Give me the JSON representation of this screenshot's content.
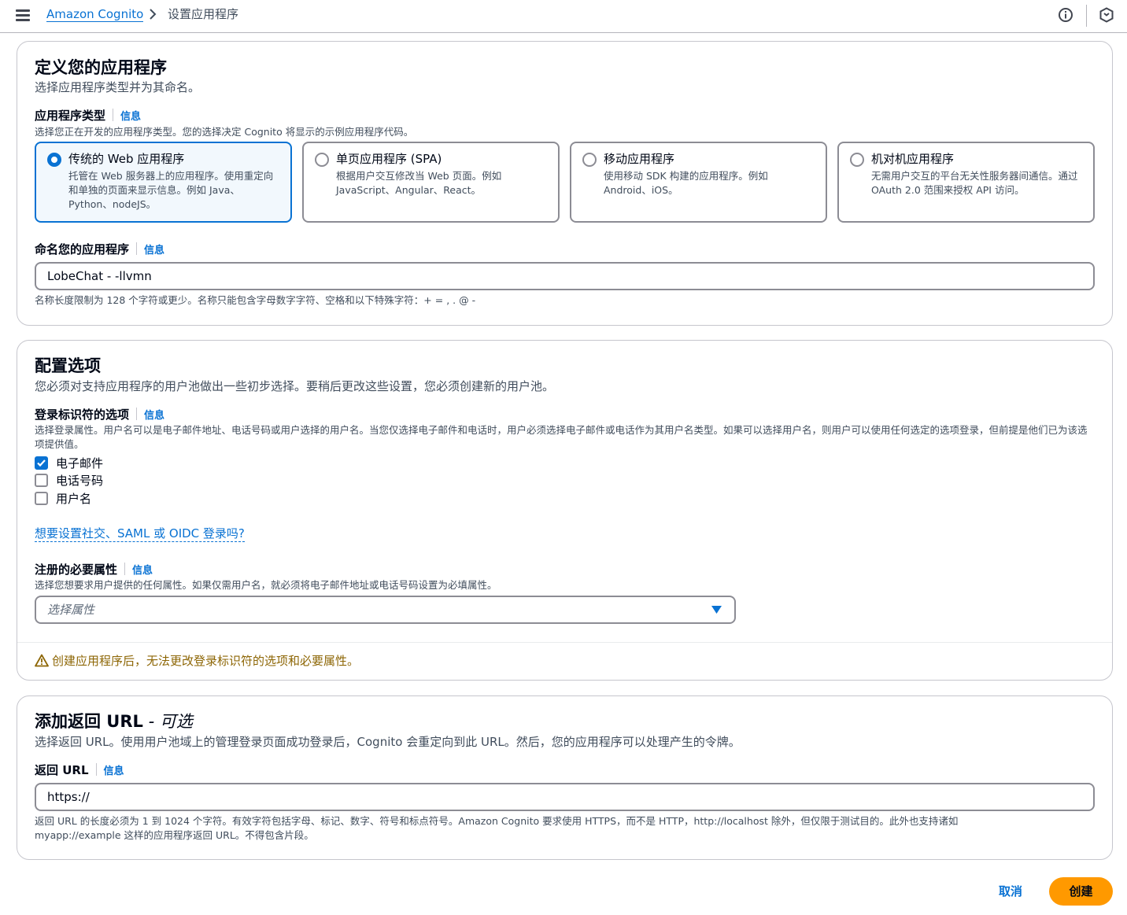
{
  "header": {
    "breadcrumb_root": "Amazon Cognito",
    "breadcrumb_current": "设置应用程序"
  },
  "define_app": {
    "title": "定义您的应用程序",
    "subtitle": "选择应用程序类型并为其命名。",
    "app_type": {
      "label": "应用程序类型",
      "info": "信息",
      "hint": "选择您正在开发的应用程序类型。您的选择决定 Cognito 将显示的示例应用程序代码。",
      "options": [
        {
          "title": "传统的 Web 应用程序",
          "desc": "托管在 Web 服务器上的应用程序。使用重定向和单独的页面来显示信息。例如 Java、Python、nodeJS。",
          "selected": true
        },
        {
          "title": "单页应用程序 (SPA)",
          "desc": "根据用户交互修改当 Web 页面。例如 JavaScript、Angular、React。",
          "selected": false
        },
        {
          "title": "移动应用程序",
          "desc": "使用移动 SDK 构建的应用程序。例如 Android、iOS。",
          "selected": false
        },
        {
          "title": "机对机应用程序",
          "desc": "无需用户交互的平台无关性服务器间通信。通过 OAuth 2.0 范围来授权 API 访问。",
          "selected": false
        }
      ]
    },
    "app_name": {
      "label": "命名您的应用程序",
      "info": "信息",
      "value": "LobeChat - -llvmn",
      "hint": "名称长度限制为 128 个字符或更少。名称只能包含字母数字字符、空格和以下特殊字符：+ = , . @ -"
    }
  },
  "config": {
    "title": "配置选项",
    "subtitle": "您必须对支持应用程序的用户池做出一些初步选择。要稍后更改这些设置，您必须创建新的用户池。",
    "signin": {
      "label": "登录标识符的选项",
      "info": "信息",
      "hint": "选择登录属性。用户名可以是电子邮件地址、电话号码或用户选择的用户名。当您仅选择电子邮件和电话时，用户必须选择电子邮件或电话作为其用户名类型。如果可以选择用户名，则用户可以使用任何选定的选项登录，但前提是他们已为该选项提供值。",
      "options": [
        {
          "label": "电子邮件",
          "checked": true
        },
        {
          "label": "电话号码",
          "checked": false
        },
        {
          "label": "用户名",
          "checked": false
        }
      ]
    },
    "social_link": "想要设置社交、SAML 或 OIDC 登录吗?",
    "required_attrs": {
      "label": "注册的必要属性",
      "info": "信息",
      "hint": "选择您想要求用户提供的任何属性。如果仅需用户名，就必须将电子邮件地址或电话号码设置为必填属性。",
      "placeholder": "选择属性"
    },
    "warning": "创建应用程序后，无法更改登录标识符的选项和必要属性。"
  },
  "return_url": {
    "title": "添加返回 URL",
    "title_suffix": " - 可选",
    "subtitle": "选择返回 URL。使用用户池域上的管理登录页面成功登录后，Cognito 会重定向到此 URL。然后，您的应用程序可以处理产生的令牌。",
    "label": "返回 URL",
    "info": "信息",
    "value": "https://",
    "hint": "返回 URL 的长度必须为 1 到 1024 个字符。有效字符包括字母、标记、数字、符号和标点符号。Amazon Cognito 要求使用 HTTPS，而不是 HTTP，http://localhost 除外，但仅限于测试目的。此外也支持诸如 myapp://example 这样的应用程序返回 URL。不得包含片段。"
  },
  "footer": {
    "cancel": "取消",
    "create": "创建"
  },
  "colors": {
    "accent": "#0972d3",
    "primary_button": "#ff9900",
    "warning": "#8d6605"
  },
  "icons": [
    "menu-icon",
    "chevron-right-icon",
    "info-circle-icon",
    "cloudshell-icon",
    "caret-down-icon",
    "warning-icon",
    "check-icon"
  ]
}
